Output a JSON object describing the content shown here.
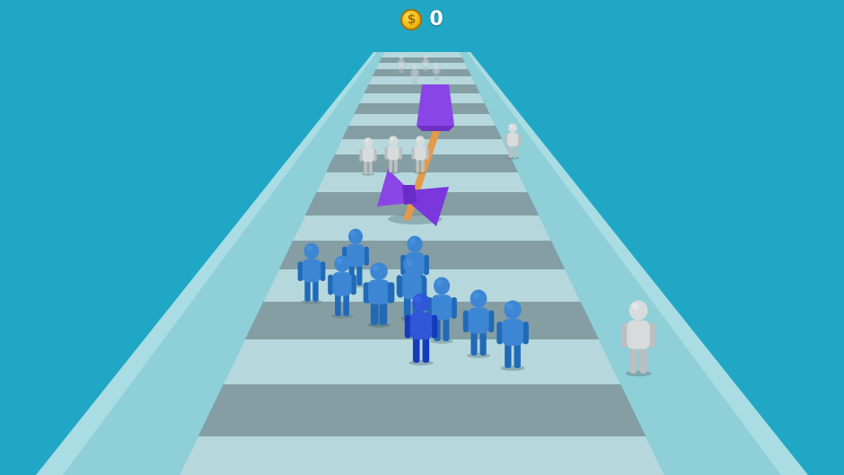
{
  "hud": {
    "coins": "0",
    "coin_icon": "gold-coin-icon",
    "coin_symbol": "$"
  },
  "colors": {
    "sky": "#21a7c6",
    "rail": "#8ecfd8",
    "rail_top": "#a9dde3",
    "stripe_light": "#b6d8dc",
    "stripe_dark": "#849ea3",
    "crowd_blue": "#3d86d4",
    "leader_blue": "#2f57d8",
    "neutral_runner": "#d7dbdc",
    "hammer_head": "#8a45e6",
    "hammer_handle": "#e39a4a"
  },
  "scene": {
    "crowd_size": 12,
    "leader_count": 1,
    "neutral_runners": 7,
    "obstacle": "swinging-hammer"
  }
}
